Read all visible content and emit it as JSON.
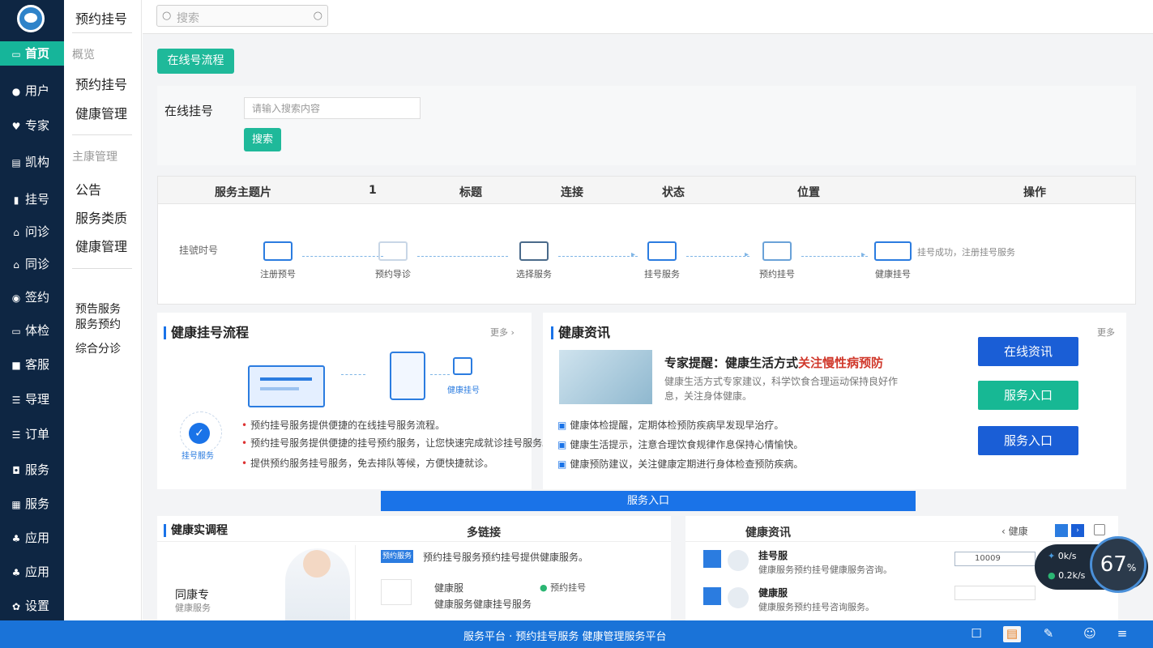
{
  "sidebar": {
    "items": [
      {
        "label": "首页",
        "icon": "monitor-icon",
        "active": true
      },
      {
        "label": "用户",
        "icon": "user-icon"
      },
      {
        "label": "专家",
        "icon": "heart-icon"
      },
      {
        "label": "凯构",
        "icon": "building-icon"
      },
      {
        "label": "挂号",
        "icon": "chart-icon"
      },
      {
        "label": "问诊",
        "icon": "home-icon"
      },
      {
        "label": "同诊",
        "icon": "home-icon"
      },
      {
        "label": "签约",
        "icon": "circle-icon"
      },
      {
        "label": "体检",
        "icon": "card-icon"
      },
      {
        "label": "客服",
        "icon": "lock-icon"
      },
      {
        "label": "导理",
        "icon": "list-icon"
      },
      {
        "label": "订单",
        "icon": "list-icon"
      },
      {
        "label": "服务",
        "icon": "camera-icon"
      },
      {
        "label": "服务",
        "icon": "grid-icon"
      },
      {
        "label": "应用",
        "icon": "people-icon"
      },
      {
        "label": "应用",
        "icon": "people-icon"
      },
      {
        "label": "设置",
        "icon": "gear-icon"
      }
    ]
  },
  "subnav": {
    "title": "预约挂号",
    "group1": "概览",
    "items1": [
      "预约挂号",
      "健康管理"
    ],
    "group2": "主康管理",
    "items2": [
      "公告",
      "服务类质",
      "健康管理"
    ],
    "items3": [
      "预告服务",
      "服务预约",
      "综合分诊"
    ]
  },
  "search": {
    "placeholder": "搜索"
  },
  "main": {
    "flow_button": "在线号流程",
    "form": {
      "label": "在线挂号",
      "placeholder": "请输入搜索内容",
      "search_button": "搜索"
    },
    "table_headers": [
      "服务主题片",
      "1",
      "标题",
      "连接",
      "状态",
      "位置",
      "操作"
    ],
    "flow": {
      "row_label": "挂號时号",
      "steps": [
        "注册预号",
        "预约导诊",
        "选择服务",
        "挂号服务",
        "预约挂号",
        "健康挂号"
      ],
      "end_note": "挂号成功，注册挂号服务"
    },
    "panel_left": {
      "title": "健康挂号流程",
      "more": "更多",
      "illus_label": "健康挂号",
      "badge_label": "挂号服务",
      "bullets": [
        "预约挂号服务提供便捷的在线挂号服务流程。",
        "预约挂号服务提供便捷的挂号预约服务，让您快速完成就诊挂号服务。",
        "提供预约服务挂号服务，免去排队等候，方便快捷就诊。"
      ]
    },
    "panel_right": {
      "title": "健康资讯",
      "more": "更多",
      "headline_a": "专家提醒：健康生活方式",
      "headline_b": "关注慢性病预防",
      "desc": "健康生活方式专家建议，科学饮食合理运动保持良好作息，关注身体健康。",
      "bullets": [
        "健康体检提醒，定期体检预防疾病早发现早治疗。",
        "健康生活提示，注意合理饮食规律作息保持心情愉快。",
        "健康预防建议，关注健康定期进行身体检查预防疾病。"
      ],
      "buttons": [
        "在线资讯",
        "服务入口",
        "服务入口"
      ]
    },
    "banner": "服务入口",
    "bottom_left": {
      "title": "健康实调程",
      "col2": "多链接",
      "doctor_name": "同康专",
      "doctor_sub": "健康服务",
      "badge": "预约服务",
      "line1": "预约挂号服务预约挂号提供健康服务。",
      "sub_title": "健康服",
      "sub_note": "预约挂号",
      "line2": "健康服务健康挂号服务"
    },
    "bottom_right": {
      "title": "健康资讯",
      "tab": "健康",
      "items": [
        {
          "name": "挂号服",
          "text": "健康服务预约挂号健康服务咨询。"
        },
        {
          "name": "健康服",
          "text": "健康服务预约挂号咨询服务。"
        }
      ],
      "field_text": "10009"
    }
  },
  "footer": {
    "text": "服务平台 · 预约挂号服务 健康管理服务平台"
  },
  "widget": {
    "up": "0k/s",
    "down": "0.2k/s",
    "value": "67",
    "suffix": "%"
  },
  "colors": {
    "sidebar": "#0e2643",
    "accent_green": "#16b59a",
    "accent_blue": "#1a5ed6",
    "footer": "#1a73d8"
  }
}
